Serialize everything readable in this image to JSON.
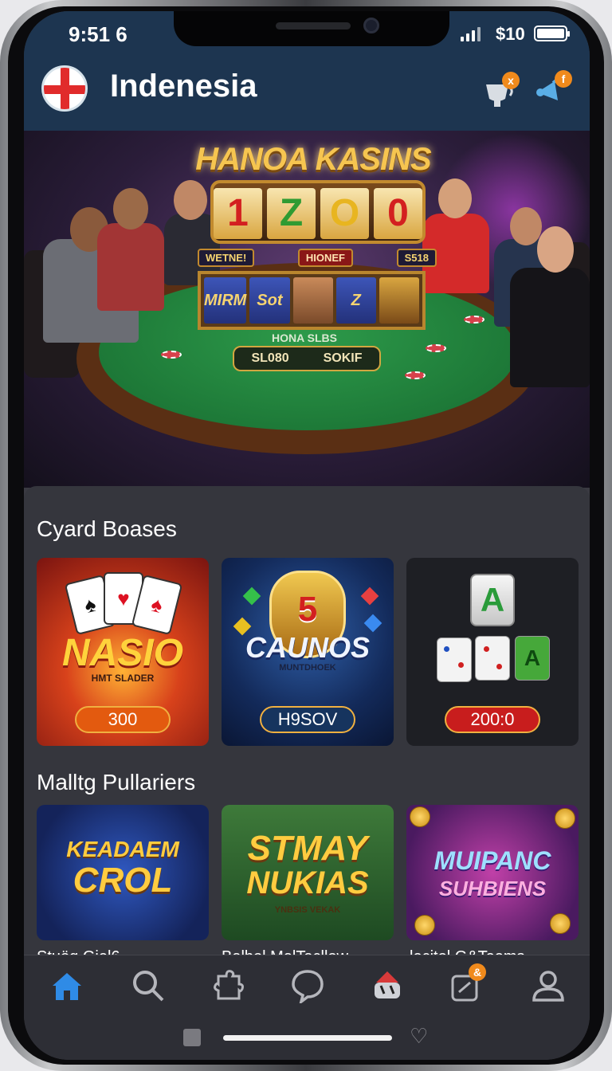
{
  "status_bar": {
    "time": "9:51 6",
    "right_text": "$10"
  },
  "header": {
    "title": "Indenesia",
    "bucket_badge": "x",
    "funnel_badge": "f"
  },
  "hero": {
    "title": "HANOA KASINS",
    "reel_digits": [
      "1",
      "Z",
      "O",
      "0"
    ],
    "labels": [
      "WETNE!",
      "HIONEF",
      "S518"
    ],
    "reel_symbols": [
      "MIRM",
      "Sot",
      "",
      "Z",
      ""
    ],
    "table_text": "HONA SLBS",
    "table_box": [
      "SL080",
      "SOKIF"
    ]
  },
  "sections": [
    {
      "title": "Cyard Boases",
      "cards": [
        {
          "big_text": "NASIO",
          "sub_text": "HMT SLADER",
          "price": "300",
          "price_color": "#e35a0f"
        },
        {
          "badge_number": "5",
          "big_text": "CAUNOS",
          "sub_text": "MUNTDHOEK",
          "price": "H9SOV",
          "price_color": "#16345e"
        },
        {
          "tile_letter": "A",
          "big_text": "",
          "price": "200:0",
          "price_color": "#c81d1d"
        }
      ]
    },
    {
      "title": "Malltg Pullariers",
      "cards": [
        {
          "line1": "KEADAEM",
          "line2": "CROL",
          "caption": "Stuög Gjel6"
        },
        {
          "line1": "STMAY",
          "line2": "NUKIAS",
          "sub_text": "YNBSIS VEKAK",
          "caption": "Balbol MalTacllow"
        },
        {
          "line1": "MUIPANC",
          "line2": "SUHBIENS",
          "caption": "lecitol G&Teems"
        }
      ]
    }
  ],
  "bottom_nav": {
    "items": [
      "home-icon",
      "search-icon",
      "puzzle-icon",
      "chat-icon",
      "casino-icon",
      "tag-icon",
      "profile-icon"
    ],
    "tag_badge": "&",
    "active_color": "#2f8be6"
  }
}
